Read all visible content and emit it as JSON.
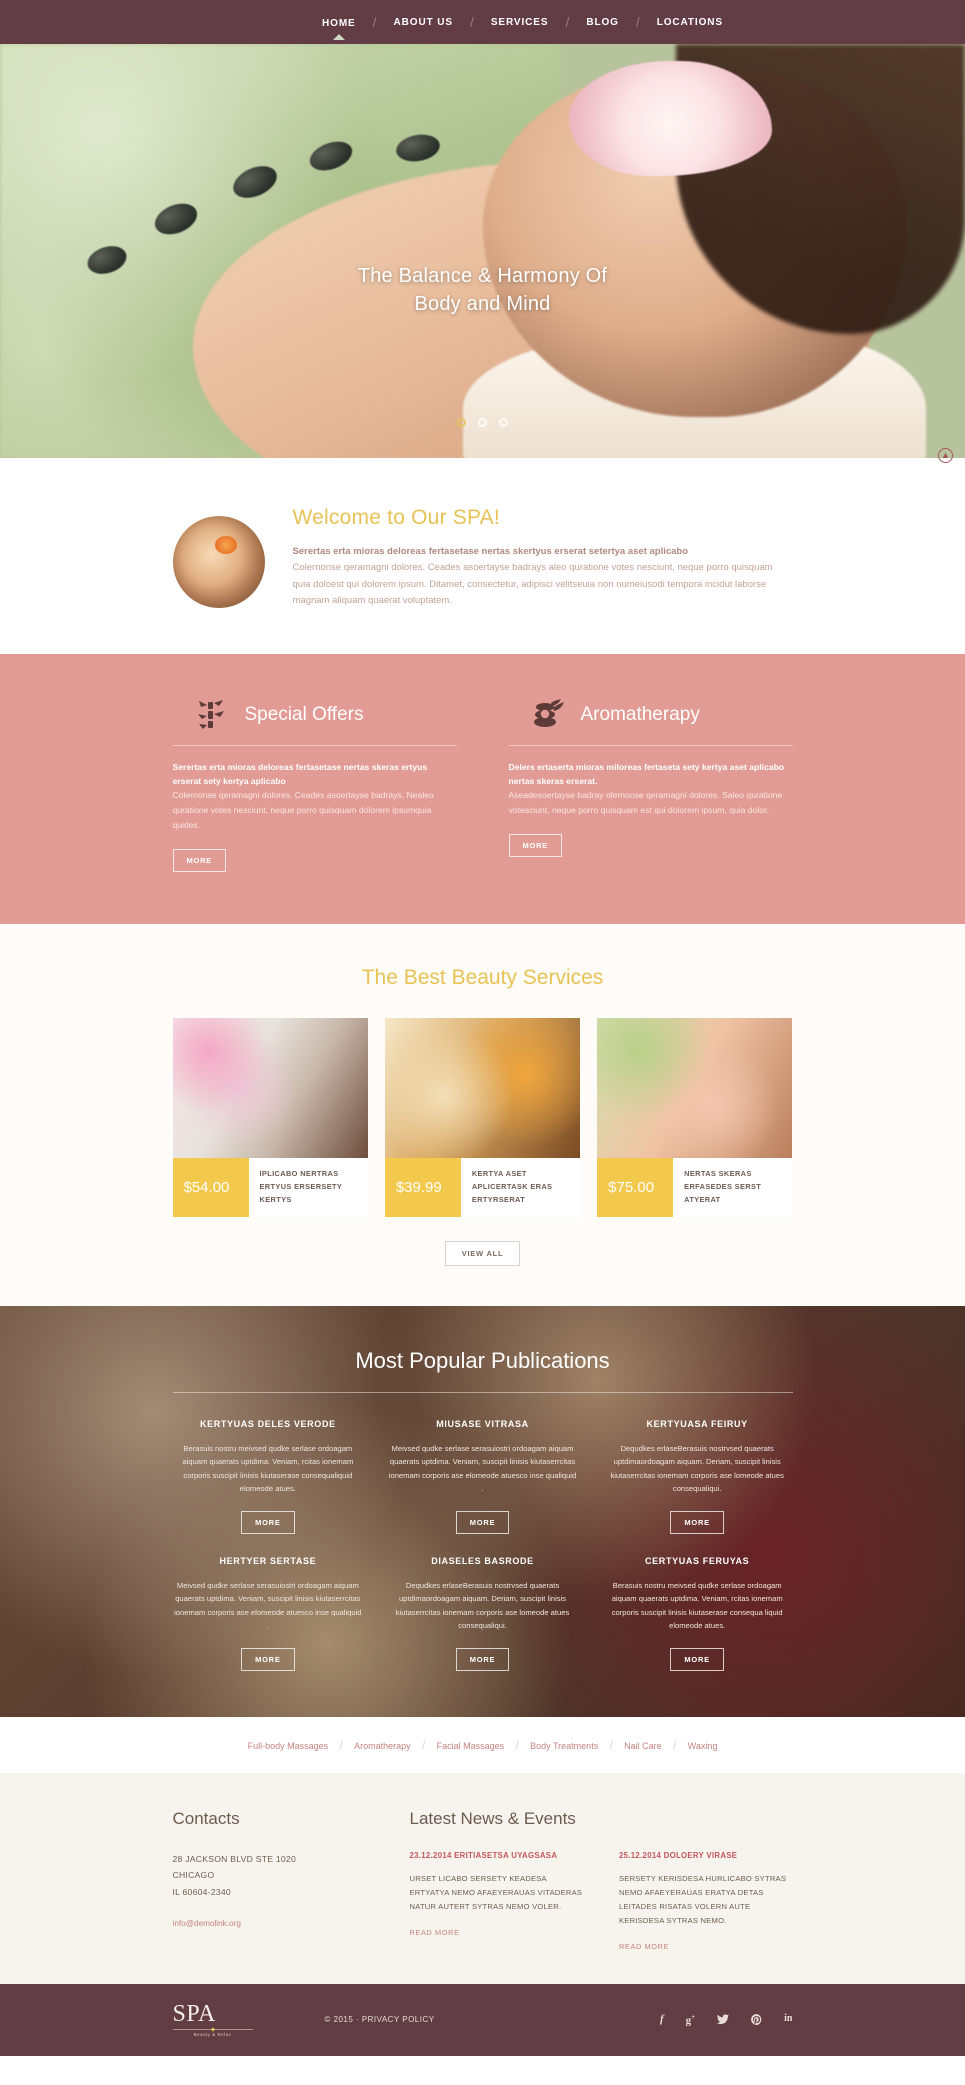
{
  "nav": {
    "items": [
      "HOME",
      "ABOUT US",
      "SERVICES",
      "BLOG",
      "LOCATIONS"
    ],
    "separator": "/"
  },
  "hero": {
    "caption_line1": "The Balance & Harmony Of",
    "caption_line2": "Body and Mind",
    "dots": 3,
    "active_dot": 1
  },
  "welcome": {
    "title": "Welcome to Our SPA!",
    "lead": "Serertas erta mioras deloreas fertasetase nertas skertyus erserat setertya aset aplicabo",
    "body": "Colernonse qeramagni dolores. Ceades asoertayse badrays aleo quratione votes nesciunt, neque porro quisquam quia doloest qui dolorem ipsum. Ditamet, consectetur, adipisci velitseuia non numeiusodi tempora incidut laborse magnam aliquam quaerat voluptatem.",
    "scrolltop_icon": "scroll-to-top-icon"
  },
  "offers": [
    {
      "icon": "bamboo-icon",
      "title": "Special Offers",
      "lead": "Serertas erta mioras deloreas fertasetase nertas skeras ertyus erserat sety kertya aplicabo",
      "body": "Colernonse qeramagni dolores. Ceades asoertayse badrays. Nealeo quratione votes nesciunt, neque porro quisquam dolorem ipsumquia quides.",
      "button": "MORE"
    },
    {
      "icon": "spa-stones-flower-icon",
      "title": "Aromatherapy",
      "lead": "Delers ertaserta mioras miloreas fertaseta sety kertya aset aplicabo nertas skeras erserat.",
      "body": "Aseadesoertayse badray olernonse qeramagni dolores. Saleo quratione votesciunt, neque porro quisquam est qui dolorem ipsum, quia dolor.",
      "button": "MORE"
    }
  ],
  "services": {
    "title": "The Best Beauty Services",
    "cards": [
      {
        "price": "$54.00",
        "label": "IPLICABO NERTRAS ERTYUS ERSERSETY KERTYS"
      },
      {
        "price": "$39.99",
        "label": "KERTYA ASET APLICERTASK ERAS ERTYRSERAT"
      },
      {
        "price": "$75.00",
        "label": "NERTAS SKERAS ERFASEDES SERST ATYERAT"
      }
    ],
    "view_all": "VIEW ALL"
  },
  "publications": {
    "title": "Most Popular Publications",
    "button": "MORE",
    "items": [
      {
        "heading": "KERTYUAS DELES VERODE",
        "text": "Berasuis nostru meivsed qudke serlase ordoagam aiquam quaerats uptdima. Veniam, rcitas ionemam corporis suscipit linisis kiutaserase consequaliquid elomeode atues."
      },
      {
        "heading": "MIUSASE VITRASA",
        "text": "Meivsed qudke serlase serasuiostri ordoagam aiquam quaerats uptdima. Veniam, suscipit linisis kiutaserrcitas ionemam corporis ase elomeode atuesco inse qualiquid ."
      },
      {
        "heading": "KERTYUASA FEIRUY",
        "text": "Dequdkes erlaseBerasuis nostrvsed quaerats uptdimaordoagam aiquam. Deriam, suscipit linisis kiutaserrcitas ionemam corporis ase lomeode atues consequaliqui."
      },
      {
        "heading": "HERTYER SERTASE",
        "text": "Meivsed qudke serlase serasuiostri ordoagam aiquam quaerats uptdima. Veniam, suscipit linisis kiutaserrcitas ionemam corporis ase elomeode atuesco inse qualiquid ."
      },
      {
        "heading": "DIASELES BASRODE",
        "text": "Dequdkes erlaseBerasuis nostrvsed quaerats uptdimaordoagam aiquam. Deriam, suscipit linisis kiutaserrcitas ionemam corporis ase lomeode atues consequaliqui."
      },
      {
        "heading": "CERTYUAS FERUYAS",
        "text": "Berasuis nostru meivsed qudke serlase ordoagam aiquam quaerats uptdima. Veniam, rcitas ionemam corporis suscipit linisis kiutaserase consequa liquid elomeode atues."
      }
    ]
  },
  "service_links": {
    "items": [
      "Full-body Massages",
      "Aromatherapy",
      "Facial Massages",
      "Body Treatments",
      "Nail Care",
      "Waxing"
    ],
    "separator": "/"
  },
  "footer": {
    "contacts_title": "Contacts",
    "address_line1": "28 JACKSON BLVD STE 1020",
    "address_line2": "CHICAGO",
    "address_line3": "IL 60604-2340",
    "email": "info@demolink.org",
    "news_title": "Latest News & Events",
    "news": [
      {
        "date": "23.12.2014 ERITIASETSA UYAGSASA",
        "text": "URSET LICABO SERSETY KEADESA ERTYATYA NEMO AFAEYERAUAS VITADERAS NATUR AUTERT SYTRAS NEMO VOLER.",
        "more": "READ MORE"
      },
      {
        "date": "25.12.2014 DOLOERY VIRASE",
        "text": "SERSETY KERISDESA HURLICABO SYTRAS NEMO AFAEYERAUAS ERATYA DETAS LEITADES RISATAS VOLERN AUTE KERISDESA SYTRAS NEMO.",
        "more": "READ MORE"
      }
    ]
  },
  "bottom": {
    "logo_main": "SPA",
    "logo_sub": "Beauty & Relax",
    "copyright": "© 2015  ·  ",
    "privacy": "PRIVACY POLICY",
    "social": [
      {
        "name": "facebook-icon",
        "glyph": "f"
      },
      {
        "name": "google-plus-icon",
        "glyph": "g+"
      },
      {
        "name": "twitter-icon",
        "glyph": "🐦"
      },
      {
        "name": "pinterest-icon",
        "glyph": "℗"
      },
      {
        "name": "linkedin-icon",
        "glyph": "in"
      }
    ]
  },
  "colors": {
    "maroon": "#603a42",
    "pink": "#e19a93",
    "gold": "#e8c255",
    "price_yellow": "#f2c94c",
    "rose_link": "#c4837e"
  }
}
